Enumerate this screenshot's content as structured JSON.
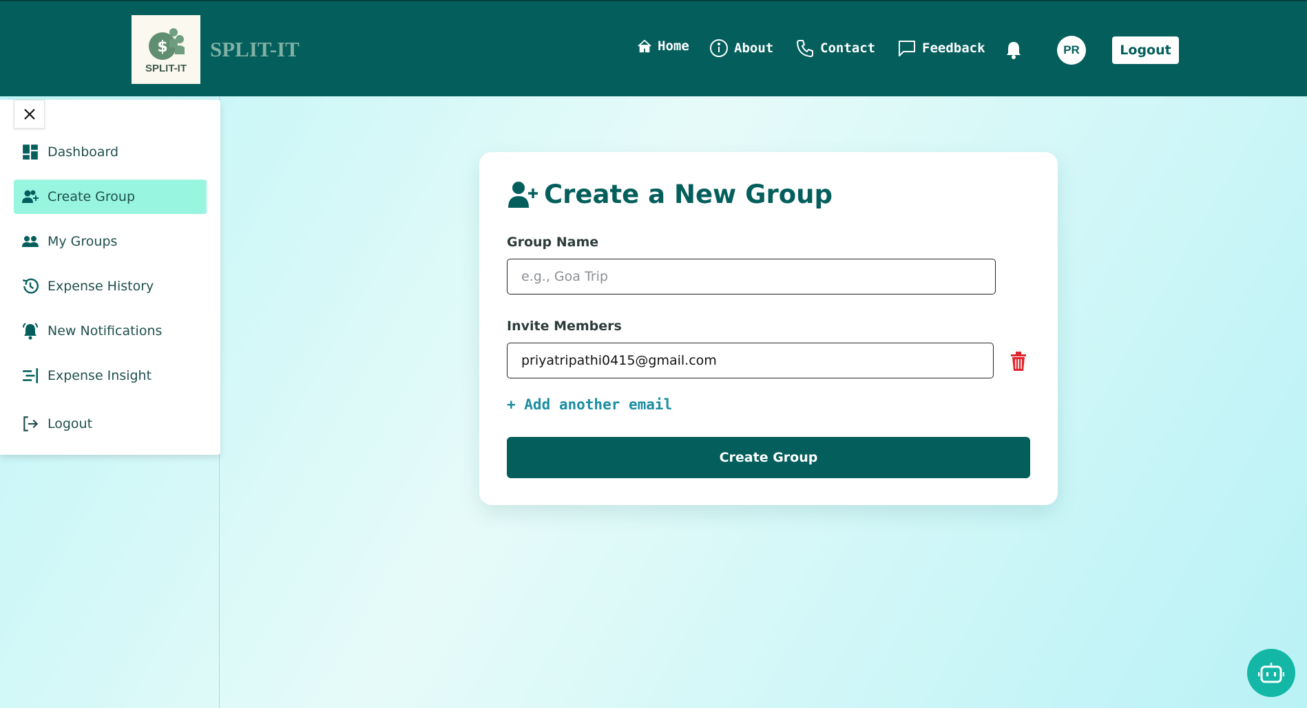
{
  "app": {
    "logo_text": "SPLIT-IT",
    "brand": "SPLIT-IT"
  },
  "nav": {
    "home": "Home",
    "about": "About",
    "contact": "Contact",
    "feedback": "Feedback",
    "avatar_initials": "PR",
    "logout": "Logout"
  },
  "sidebar": {
    "items": [
      {
        "label": "Dashboard",
        "icon": "dashboard-icon"
      },
      {
        "label": "Create Group",
        "icon": "add-user-icon",
        "active": true
      },
      {
        "label": "My Groups",
        "icon": "groups-icon"
      },
      {
        "label": "Expense History",
        "icon": "history-icon"
      },
      {
        "label": "New Notifications",
        "icon": "notification-bell-icon"
      },
      {
        "label": "Expense Insight",
        "icon": "insight-icon"
      },
      {
        "label": "Logout",
        "icon": "logout-icon"
      }
    ]
  },
  "form": {
    "title": "Create a New Group",
    "group_name_label": "Group Name",
    "group_name_placeholder": "e.g., Goa Trip",
    "invite_label": "Invite Members",
    "invite_email_value": "priyatripathi0415@gmail.com",
    "add_email": "+ Add another email",
    "submit": "Create Group"
  },
  "colors": {
    "primary": "#035e5c",
    "active_item": "#97f5e0",
    "delete": "#e0262d",
    "link": "#1a8da0",
    "chatbot": "#14b7a6"
  }
}
